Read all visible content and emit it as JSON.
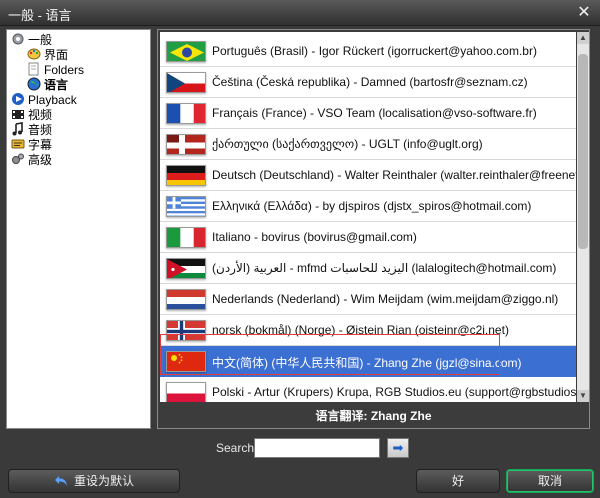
{
  "window": {
    "title": "一般 - 语言",
    "close_icon": "close-icon"
  },
  "tree": {
    "items": [
      {
        "label": "一般",
        "icon": "gear-icon",
        "indent": 0,
        "bold": false
      },
      {
        "label": "界面",
        "icon": "paint-palette-icon",
        "indent": 1,
        "bold": false
      },
      {
        "label": "Folders",
        "icon": "folder-icon",
        "indent": 1,
        "bold": false
      },
      {
        "label": "语言",
        "icon": "globe-icon",
        "indent": 1,
        "bold": true
      },
      {
        "label": "Playback",
        "icon": "play-icon",
        "indent": 0,
        "bold": false
      },
      {
        "label": "视频",
        "icon": "video-icon",
        "indent": 0,
        "bold": false
      },
      {
        "label": "音频",
        "icon": "music-note-icon",
        "indent": 0,
        "bold": false
      },
      {
        "label": "字幕",
        "icon": "subtitles-icon",
        "indent": 0,
        "bold": false
      },
      {
        "label": "高级",
        "icon": "advanced-gear-icon",
        "indent": 0,
        "bold": false
      }
    ]
  },
  "languages": [
    {
      "flag": "br",
      "text": "Português (Brasil) - Igor Rückert (igorruckert@yahoo.com.br)"
    },
    {
      "flag": "cz",
      "text": "Čeština (Česká republika) - Damned (bartosfr@seznam.cz)"
    },
    {
      "flag": "fr",
      "text": "Français (France) - VSO Team (localisation@vso-software.fr)"
    },
    {
      "flag": "ge",
      "text": "ქართული (საქართველო) - UGLT (info@uglt.org)"
    },
    {
      "flag": "de",
      "text": "Deutsch (Deutschland) - Walter Reinthaler (walter.reinthaler@freenet.de)"
    },
    {
      "flag": "gr",
      "text": "Ελληνικά (Ελλάδα) - by djspiros (djstx_spiros@hotmail.com)"
    },
    {
      "flag": "it",
      "text": "Italiano - bovirus (bovirus@gmail.com)"
    },
    {
      "flag": "jo",
      "text": "(الأردن) العربية - mfmd اليزيد للحاسبات (lalalogitech@hotmail.com)"
    },
    {
      "flag": "nl",
      "text": "Nederlands (Nederland) - Wim Meijdam (wim.meijdam@ziggo.nl)"
    },
    {
      "flag": "no",
      "text": "norsk (bokmål) (Norge) - Øistein Rian (oisteinr@c2i.net)"
    },
    {
      "flag": "cn",
      "text": "中文(简体) (中华人民共和国) - Zhang Zhe (jgzl@sina.com)",
      "selected": true
    },
    {
      "flag": "pl",
      "text": "Polski - Artur (Krupers) Krupa, RGB Studios.eu (support@rgbstudios.eu)"
    }
  ],
  "translator": "语言翻译: Zhang Zhe",
  "search": {
    "label": "Search:",
    "value": ""
  },
  "buttons": {
    "reset": "重设为默认",
    "ok": "好",
    "cancel": "取消"
  },
  "colors": {
    "selection": "#3b6fd1",
    "highlight_box": "#e33c3c",
    "cancel_border": "#19a85a"
  }
}
